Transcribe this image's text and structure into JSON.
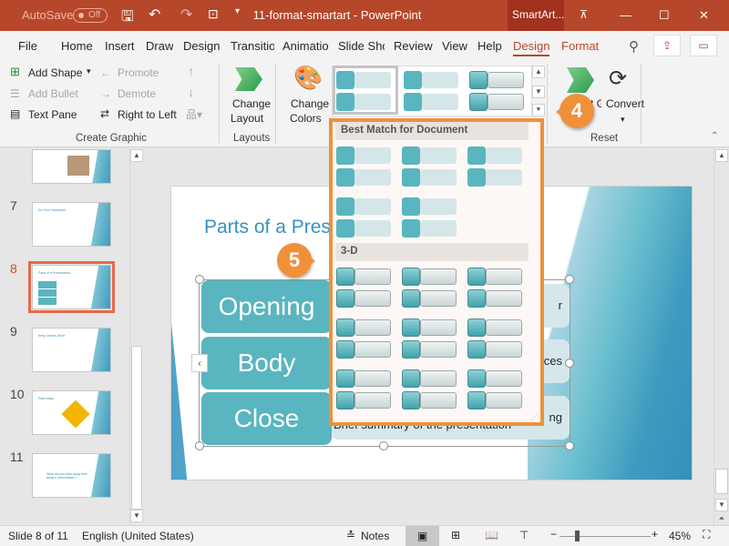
{
  "titlebar": {
    "autosave_label": "AutoSave",
    "autosave_state": "Off",
    "title": "11-format-smartart  -  PowerPoint",
    "context_tab": "SmartArt...",
    "minimize": "—",
    "maximize": "☐",
    "close": "✕"
  },
  "tabs": [
    "File",
    "Home",
    "Insert",
    "Draw",
    "Design",
    "Transitio",
    "Animatio",
    "Slide Sho",
    "Review",
    "View",
    "Help",
    "Design",
    "Format"
  ],
  "active_tab": "Design",
  "ribbon": {
    "create_graphic": {
      "add_shape": "Add Shape",
      "add_bullet": "Add Bullet",
      "text_pane": "Text Pane",
      "promote": "Promote",
      "demote": "Demote",
      "right_to_left": "Right to Left",
      "label": "Create Graphic"
    },
    "layouts": {
      "change_layout_1": "Change",
      "change_layout_2": "Layout",
      "label": "Layouts"
    },
    "styles": {
      "change_colors_1": "Change",
      "change_colors_2": "Colors"
    },
    "reset": {
      "reset_graphic": "Reset Graphic",
      "convert": "Convert",
      "label": "Reset"
    }
  },
  "gallery": {
    "section1": "Best Match for Document",
    "section2": "3-D"
  },
  "callouts": {
    "step4": "4",
    "step5": "5"
  },
  "slides": [
    {
      "num": "",
      "title": ""
    },
    {
      "num": "7",
      "title": "Do Your Homework"
    },
    {
      "num": "8",
      "title": "Parts of a Presentation"
    },
    {
      "num": "9",
      "title": "Keep Videos Short"
    },
    {
      "num": "10",
      "title": "Plain Away"
    },
    {
      "num": "11",
      "title": "What did you take away from today's presentation?"
    }
  ],
  "selected_slide": "8",
  "slide": {
    "title": "Parts of a Presentation",
    "shapes": [
      "Opening",
      "Body",
      "Close"
    ],
    "texts": [
      "r",
      "ces",
      "ng",
      "Brief summary of the presentation"
    ]
  },
  "status": {
    "slide_info": "Slide 8 of 11",
    "language": "English (United States)",
    "notes": "Notes",
    "zoom": "45%"
  },
  "colors": {
    "accent": "#B7472A",
    "callout": "#F0913A",
    "smartart": "#59B5BF"
  }
}
